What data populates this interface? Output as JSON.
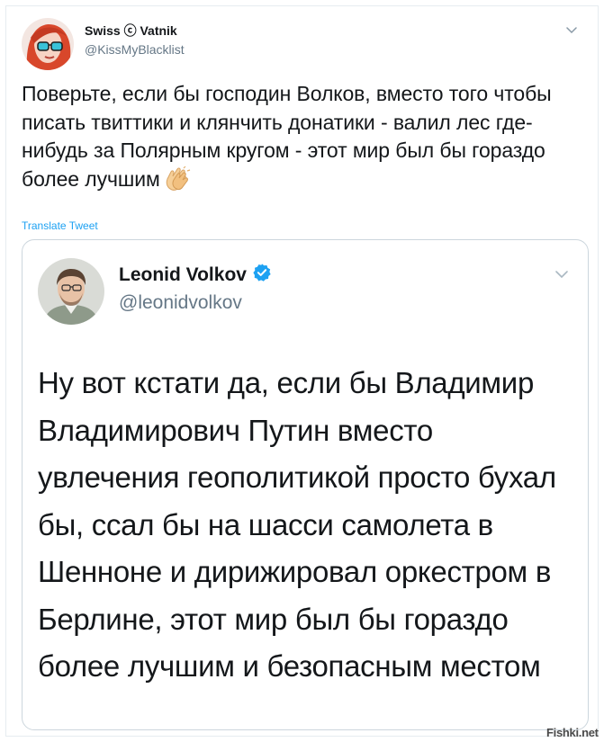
{
  "tweet": {
    "author_name": "Swiss ⓒ Vatnik",
    "author_handle": "@KissMyBlacklist",
    "text": "Поверьте, если бы господин Волков, вместо того чтобы писать твиттики и клянчить донатики - валил лес где-нибудь за Полярным кругом - этот мир был бы гораздо более лучшим",
    "emoji": "clapping-hands",
    "translate_label": "Translate Tweet",
    "caret_icon": "chevron-down-icon"
  },
  "quoted_tweet": {
    "author_name": "Leonid Volkov",
    "verified": true,
    "author_handle": "@leonidvolkov",
    "text": "Ну вот кстати да, если бы Владимир Владимирович Путин вместо увлечения геополитикой просто бухал бы, ссал бы на шасси самолета в Шенноне и дирижировал оркестром в Берлине, этот мир был бы гораздо более лучшим и безопасным местом",
    "caret_icon": "chevron-down-icon"
  },
  "watermark": "Fishki.net",
  "colors": {
    "text": "#14171a",
    "secondary": "#657786",
    "link": "#1da1f2",
    "border": "#ccd6dd"
  }
}
